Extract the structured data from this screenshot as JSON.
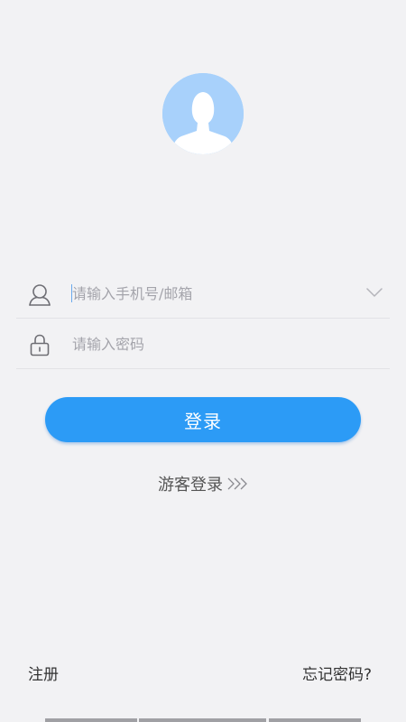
{
  "avatar": {
    "icon": "user-silhouette-icon"
  },
  "form": {
    "username_placeholder": "请输入手机号/邮箱",
    "password_placeholder": "请输入密码",
    "user_icon": "user-outline-icon",
    "lock_icon": "lock-icon",
    "dropdown_icon": "chevron-down-icon"
  },
  "login_button_label": "登录",
  "guest_login_label": "游客登录",
  "footer": {
    "register_label": "注册",
    "forgot_password_label": "忘记密码?"
  },
  "colors": {
    "background": "#f2f2f4",
    "accent": "#2c9bf6",
    "avatar_bg": "#a8d1fb",
    "placeholder": "#a4a4ab"
  }
}
